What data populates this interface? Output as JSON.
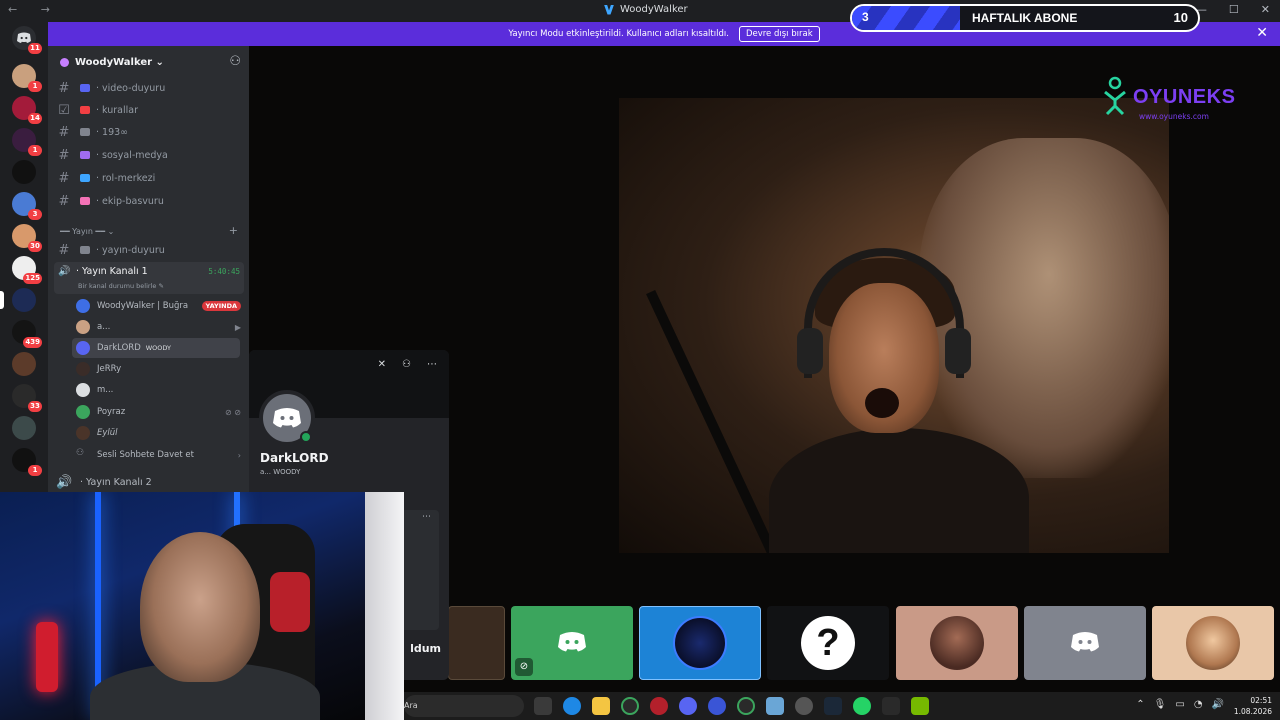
{
  "titlebar": {
    "title": "WoodyWalker",
    "nav": "← →",
    "controls": [
      "—",
      "☐",
      "✕"
    ]
  },
  "goal": {
    "current": "3",
    "label": "HAFTALIK ABONE",
    "target": "10",
    "progress": 0.3
  },
  "notice": {
    "text": "Yayıncı Modu etkinleştirildi. Kullanıcı adları kısaltıldı.",
    "button": "Devre dışı bırak",
    "close": "✕"
  },
  "rail": {
    "badges": [
      "11",
      "1",
      "14",
      "1",
      "3",
      "30",
      "125",
      "439",
      "33",
      "1"
    ]
  },
  "server": {
    "name": "WoodyWalker ⌄",
    "invite_icon": "invite-icon"
  },
  "channels": [
    {
      "name": "· video-duyuru",
      "color": "#5865f2"
    },
    {
      "name": "· kurallar",
      "color": "#f23f43"
    },
    {
      "name": "· 193∞",
      "color": "#80848e"
    },
    {
      "name": "· sosyal-medya",
      "color": "#a06cf0"
    },
    {
      "name": "· rol-merkezi",
      "color": "#3ea6ff"
    },
    {
      "name": "· ekip-basvuru",
      "color": "#f472b6"
    }
  ],
  "category": {
    "name": "━━ Yayın ━━ ⌄",
    "plus": "+"
  },
  "announce": {
    "name": "· yayın-duyuru"
  },
  "voice": {
    "name": "· Yayın Kanalı 1",
    "time": "5:40:45",
    "sub": "Bir kanal durumu belirle ✎",
    "members": [
      {
        "name": "WoodyWalker | Buğra",
        "live": "YAYINDA",
        "color": "#3e6ee6"
      },
      {
        "name": "a...",
        "icon": "🎥",
        "color": "#caa184"
      },
      {
        "name": "DarkLORD",
        "tag": "WOODY",
        "color": "#5865f2"
      },
      {
        "name": "JeRRy",
        "color": "#3a2c28"
      },
      {
        "name": "m...",
        "color": "#dbdee1"
      },
      {
        "name": "Poyraz",
        "icon": "🔇",
        "color": "#3ba55d"
      },
      {
        "name": "Eylül",
        "color": "#4a3429"
      }
    ],
    "invite": "Sesli Sohbete Davet et",
    "invite_arrow": "›"
  },
  "voice2": {
    "name": "· Yayın Kanalı 2"
  },
  "popout": {
    "name": "DarkLORD",
    "sub": "a...  WOODY",
    "send_label": "ldum",
    "icons": [
      "✕",
      "⚇",
      "⋯"
    ],
    "more": "⋯"
  },
  "logo": {
    "brand": "OYUNEKS",
    "url": "www.oyuneks.com",
    "mascot": "oyuneks-mascot-icon"
  },
  "tiles": [
    {
      "kind": "video",
      "color": "#3a2b20"
    },
    {
      "kind": "discord",
      "color": "#3ba55d",
      "icon": "⊘"
    },
    {
      "kind": "avatar",
      "color": "#1d83d6"
    },
    {
      "kind": "question",
      "color": "#111214"
    },
    {
      "kind": "photo",
      "color": "#c99a87"
    },
    {
      "kind": "discord",
      "color": "#80848e"
    },
    {
      "kind": "memoji",
      "color": "#e9c7a8"
    }
  ],
  "taskbar": {
    "search": "Ara",
    "time": "02:51",
    "date": "1.08.2026"
  },
  "colors": {
    "accent": "#5b2ddb",
    "online": "#23a55a",
    "live": "#da373c",
    "bg": "#2b2d31"
  }
}
